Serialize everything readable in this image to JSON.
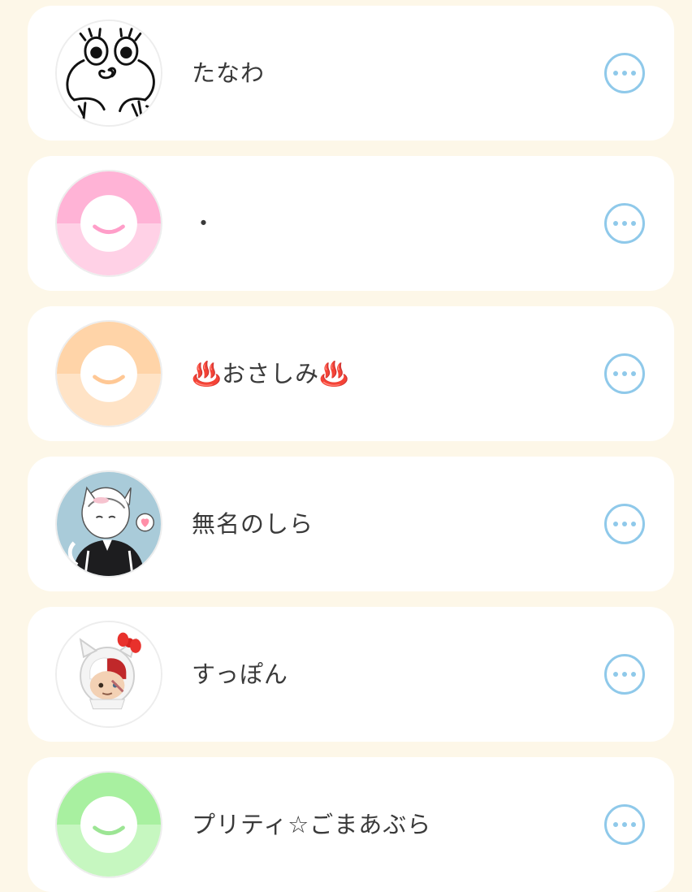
{
  "colors": {
    "background": "#fdf7e8",
    "card": "#ffffff",
    "more_button": "#8fc9ea",
    "text": "#3a3a3a"
  },
  "users": [
    {
      "name": "たなわ",
      "avatar": "drawing-avatar"
    },
    {
      "name": "・",
      "avatar": "default-pink"
    },
    {
      "name": "♨️おさしみ♨️",
      "avatar": "default-orange"
    },
    {
      "name": "無名のしら",
      "avatar": "illustration-avatar"
    },
    {
      "name": "すっぽん",
      "avatar": "figure-avatar"
    },
    {
      "name": "プリティ☆ごまあぶら",
      "avatar": "default-green"
    }
  ],
  "avatar_colors": {
    "default-pink": {
      "top": "#ffb3d6",
      "bottom": "#ffd1e6",
      "smile": "#ff9ec9"
    },
    "default-orange": {
      "top": "#ffd4a8",
      "bottom": "#ffe3c6",
      "smile": "#ffc895"
    },
    "default-green": {
      "top": "#a8f0a0",
      "bottom": "#c6f7c0",
      "smile": "#9ce594"
    }
  },
  "more_icon": "more-options-icon"
}
